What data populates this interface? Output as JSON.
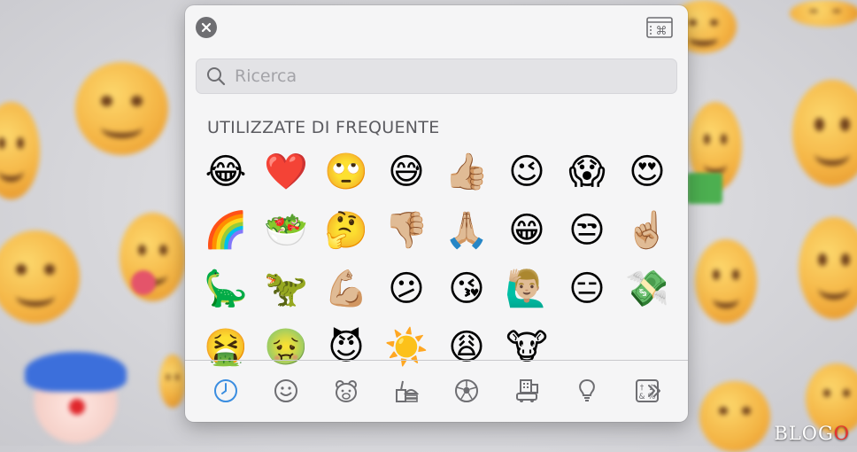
{
  "window": {
    "close_label": "close",
    "search_placeholder": "Ricerca",
    "section_title": "UTILIZZATE DI FREQUENTE"
  },
  "emoji_rows": [
    [
      "😂",
      "❤️",
      "🙄",
      "😅",
      "👍🏼",
      "😉",
      "😱",
      "😍"
    ],
    [
      "🌈",
      "🥗",
      "🤔",
      "👎🏼",
      "🙏🏼",
      "😁",
      "😒",
      "☝🏼"
    ],
    [
      "🦕",
      "🦖",
      "💪🏼",
      "😕",
      "😘",
      "🙋🏼‍♂️",
      "😑",
      "💸"
    ],
    [
      "🤮",
      "🤢",
      "😈",
      "☀️",
      "😩",
      "🐮"
    ]
  ],
  "categories": [
    {
      "icon": "clock-icon",
      "selected": true
    },
    {
      "icon": "smiley-icon",
      "selected": false
    },
    {
      "icon": "bear-icon",
      "selected": false
    },
    {
      "icon": "food-icon",
      "selected": false
    },
    {
      "icon": "soccer-ball-icon",
      "selected": false
    },
    {
      "icon": "buildings-car-icon",
      "selected": false
    },
    {
      "icon": "lightbulb-icon",
      "selected": false
    },
    {
      "icon": "symbols-icon",
      "selected": false
    },
    {
      "icon": "flag-icon",
      "selected": false
    },
    {
      "icon": "more-icon",
      "selected": false
    }
  ],
  "colors": {
    "accent": "#3a8de0",
    "icon_gray": "#6e6e72"
  },
  "watermark": {
    "text_a": "BLOG",
    "text_b": "O"
  }
}
